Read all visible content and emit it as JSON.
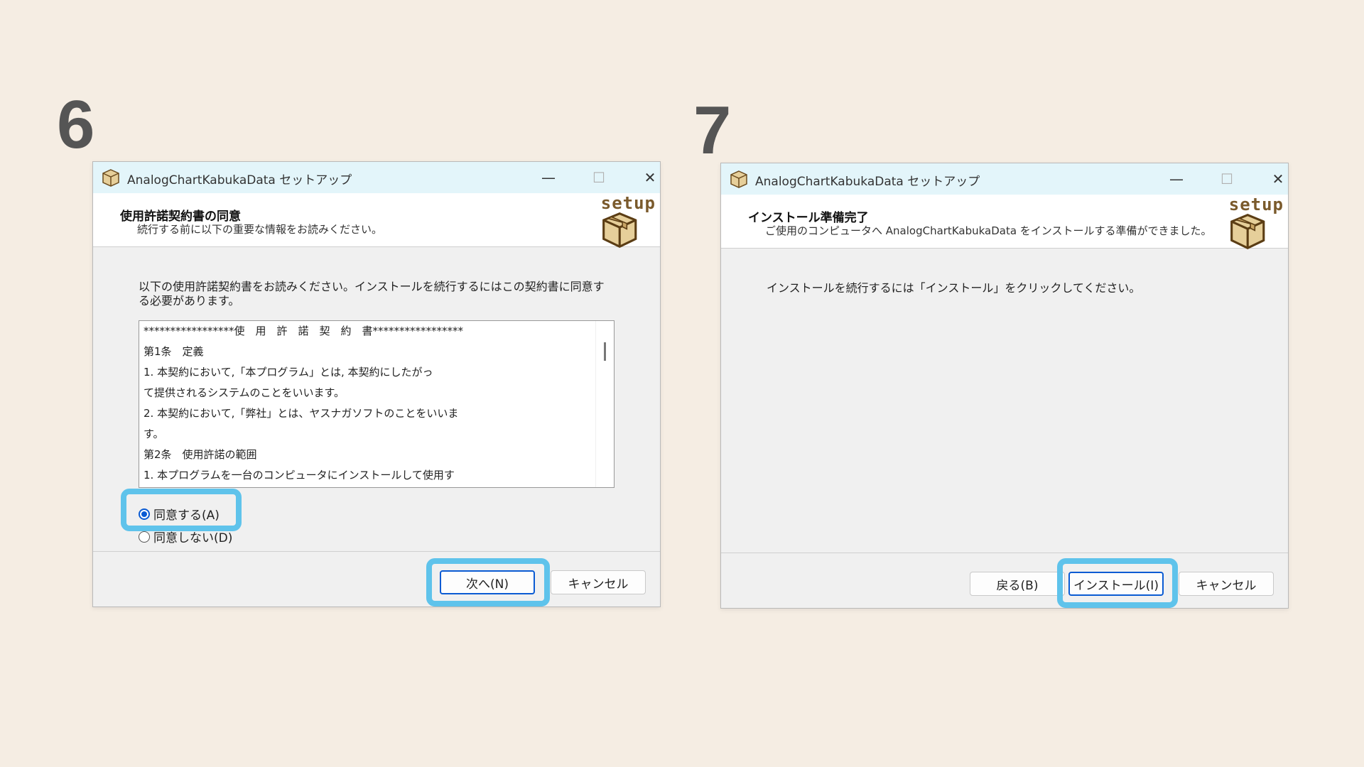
{
  "step6": {
    "number": "6",
    "dialog": {
      "title": "AnalogChartKabukaData セットアップ",
      "header_title": "使用許諾契約書の同意",
      "header_sub": "続行する前に以下の重要な情報をお読みください。",
      "setup_logo": "setup",
      "instruction": "以下の使用許諾契約書をお読みください。インストールを続行するにはこの契約書に同意する必要があります。",
      "license_lines": [
        "*****************使　用　許　諾　契　約　書*****************",
        " 第1条　定義",
        "1. 本契約において,「本プログラム」とは, 本契約にしたがっ",
        "て提供されるシステムのことをいいます。",
        "2. 本契約において,「弊社」とは、ヤスナガソフトのことをいいま",
        "す。",
        "第2条　使用許諾の範囲",
        "1. 本プログラムを一台のコンピュータにインストールして使用す"
      ],
      "radio_agree": "同意する(A)",
      "radio_disagree": "同意しない(D)",
      "next_button": "次へ(N)",
      "cancel_button": "キャンセル"
    }
  },
  "step7": {
    "number": "7",
    "dialog": {
      "title": "AnalogChartKabukaData セットアップ",
      "header_title": "インストール準備完了",
      "header_sub": "ご使用のコンピュータへ AnalogChartKabukaData をインストールする準備ができました。",
      "setup_logo": "setup",
      "instruction": "インストールを続行するには「インストール」をクリックしてください。",
      "back_button": "戻る(B)",
      "install_button": "インストール(I)",
      "cancel_button": "キャンセル"
    }
  },
  "window_controls": {
    "minimize": "—",
    "maximize": "☐",
    "close": "✕"
  },
  "colors": {
    "background": "#f5ede3",
    "highlight": "#5fc3eb",
    "accent": "#0a5bd3",
    "titlebar": "#e3f5fa"
  }
}
